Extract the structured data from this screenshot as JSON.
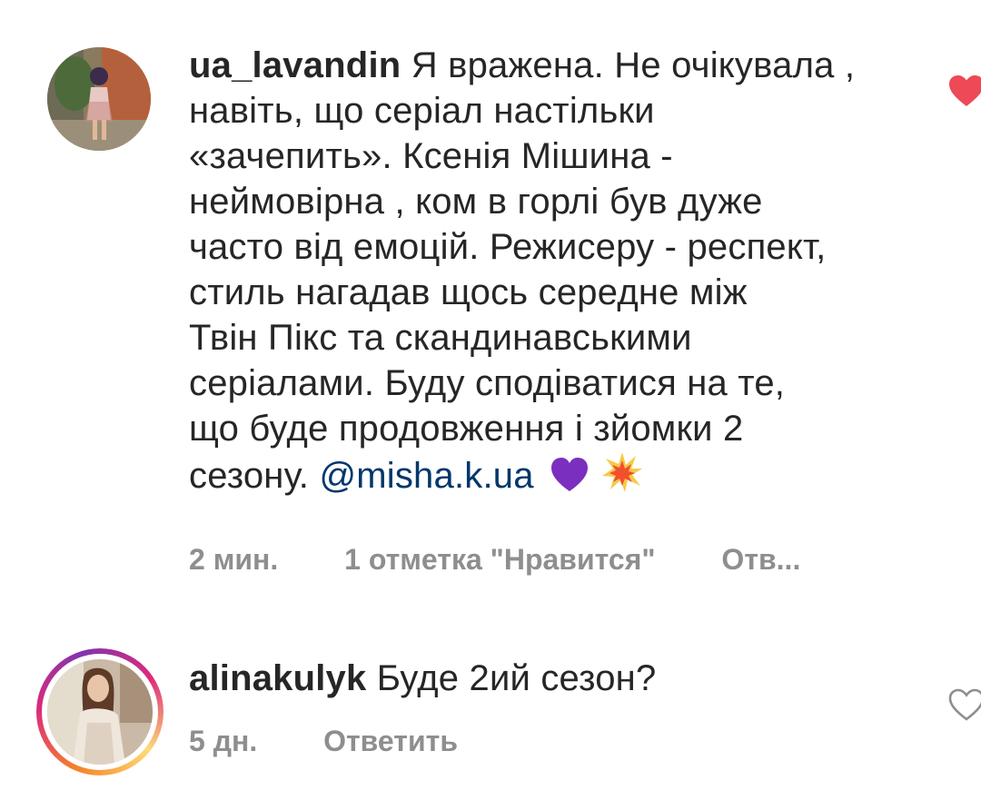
{
  "comments": [
    {
      "username": "ua_lavandin",
      "lines": [
        "Я вражена. Не очікувала ,",
        "навіть, що серіал настільки",
        "«зачепить». Ксенія Мішина -",
        "неймовірна , ком в горлі був дуже",
        "часто від емоцій. Режисеру - респект,",
        "стиль нагадав щось середне між",
        "Твін Пікс та скандинавськими",
        "серіалами. Буду сподіватися на те,",
        "що буде продовження і зйомки 2",
        "сезону."
      ],
      "mention": "@misha.k.ua",
      "emojis": [
        "purple-heart-icon",
        "collision-icon"
      ],
      "time": "2 мин.",
      "likes": "1 отметка \"Нравится\"",
      "reply": "Отв...",
      "liked": true,
      "like_color": "#ed4956"
    },
    {
      "username": "alinakulyk",
      "text": "Буде 2ий сезон?",
      "time": "5 дн.",
      "reply": "Ответить",
      "liked": false
    }
  ]
}
